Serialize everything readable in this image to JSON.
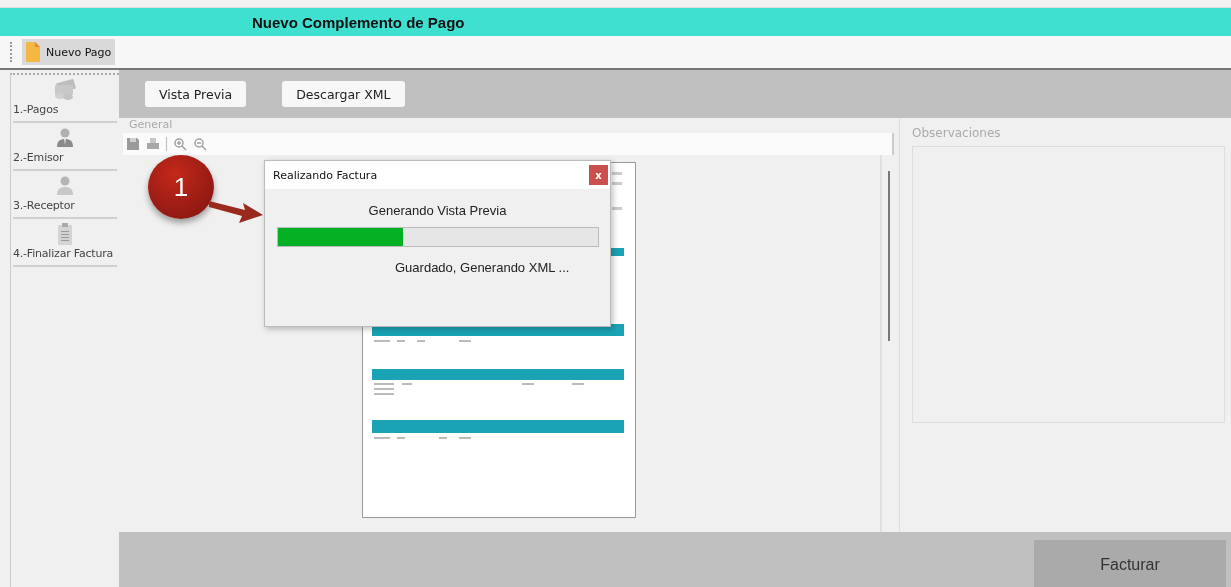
{
  "window": {
    "title": "Nuevo Complemento de Pago"
  },
  "toolbar": {
    "buttons": [
      {
        "label": "Nuevo Pago"
      }
    ]
  },
  "sidebar": {
    "items": [
      {
        "label": "1.-Pagos"
      },
      {
        "label": "2.-Emisor"
      },
      {
        "label": "3.-Receptor"
      },
      {
        "label": "4.-Finalizar Factura"
      }
    ]
  },
  "actions": {
    "buttons": [
      "Vista Previa",
      "Descargar XML"
    ]
  },
  "general": {
    "title": "General"
  },
  "observaciones": {
    "title": "Observaciones"
  },
  "footer": {
    "button": "Facturar"
  },
  "callout": {
    "label": "1"
  },
  "dialog": {
    "title": "Realizando Factura",
    "close": "x",
    "message": "Generando Vista Previa",
    "progress": {
      "level": 0.39
    },
    "status": "Guardado, Generando XML ..."
  }
}
